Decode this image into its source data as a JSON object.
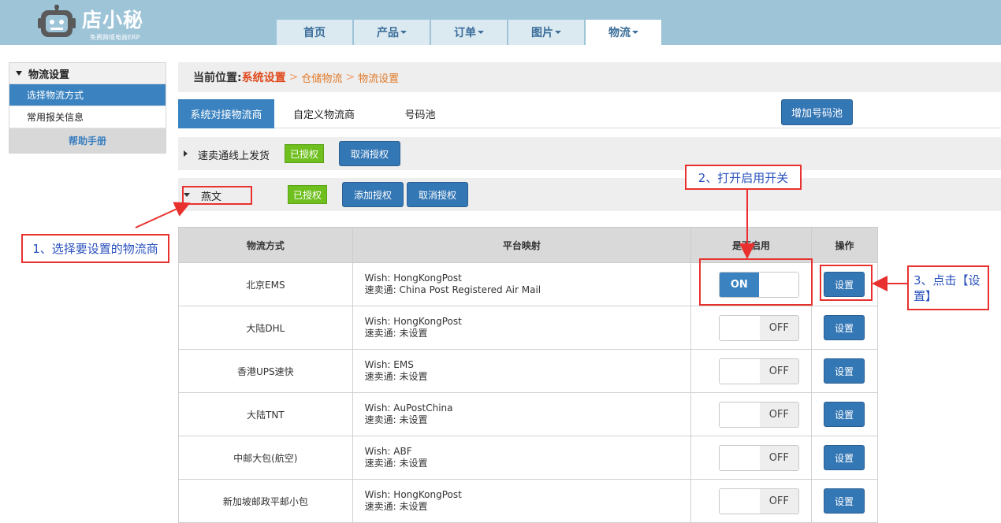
{
  "header": {
    "logo_title": "店小秘",
    "logo_subtitle": "免费跨境电商ERP",
    "nav": [
      {
        "label": "首页",
        "has_caret": false
      },
      {
        "label": "产品",
        "has_caret": true
      },
      {
        "label": "订单",
        "has_caret": true
      },
      {
        "label": "图片",
        "has_caret": true
      },
      {
        "label": "物流",
        "has_caret": true
      }
    ]
  },
  "sidebar": {
    "title": "物流设置",
    "items": [
      {
        "label": "选择物流方式",
        "active": true
      },
      {
        "label": "常用报关信息",
        "active": false
      }
    ],
    "help": "帮助手册"
  },
  "breadcrumb": {
    "label": "当前位置:",
    "level1": "系统设置",
    "level2": "仓储物流",
    "level3": "物流设置"
  },
  "subtabs": {
    "tab1": "系统对接物流商",
    "tab2": "自定义物流商",
    "tab3": "号码池",
    "add_pool_button": "增加号码池"
  },
  "providers": [
    {
      "name": "速卖通线上发货",
      "status": "已授权",
      "cancel": "取消授权"
    },
    {
      "name": "燕文",
      "status": "已授权",
      "add": "添加授权",
      "cancel": "取消授权"
    }
  ],
  "table": {
    "headers": {
      "method": "物流方式",
      "mapping": "平台映射",
      "enabled": "是否启用",
      "action": "操作"
    },
    "rows": [
      {
        "name": "北京EMS",
        "wish": "Wish:  HongKongPost",
        "smt": "速卖通:  China Post Registered Air Mail",
        "enabled": true,
        "switch_label": "ON",
        "button": "设置"
      },
      {
        "name": "大陆DHL",
        "wish": "Wish:  HongKongPost",
        "smt": "速卖通:  未设置",
        "enabled": false,
        "switch_label": "OFF",
        "button": "设置"
      },
      {
        "name": "香港UPS速快",
        "wish": "Wish:  EMS",
        "smt": "速卖通:  未设置",
        "enabled": false,
        "switch_label": "OFF",
        "button": "设置"
      },
      {
        "name": "大陆TNT",
        "wish": "Wish:  AuPostChina",
        "smt": "速卖通:  未设置",
        "enabled": false,
        "switch_label": "OFF",
        "button": "设置"
      },
      {
        "name": "中邮大包(航空)",
        "wish": "Wish:  ABF",
        "smt": "速卖通:  未设置",
        "enabled": false,
        "switch_label": "OFF",
        "button": "设置"
      },
      {
        "name": "新加坡邮政平邮小包",
        "wish": "Wish:  HongKongPost",
        "smt": "速卖通:  未设置",
        "enabled": false,
        "switch_label": "OFF",
        "button": "设置"
      }
    ]
  },
  "annotations": {
    "step1": "1、选择要设置的物流商",
    "step2": "2、打开启用开关",
    "step3": "3、点击【设置】"
  },
  "colors": {
    "header_bg": "#9ec4d8",
    "accent": "#3b83c0",
    "badge": "#6fbf1f",
    "annotation": "#e8312f"
  }
}
